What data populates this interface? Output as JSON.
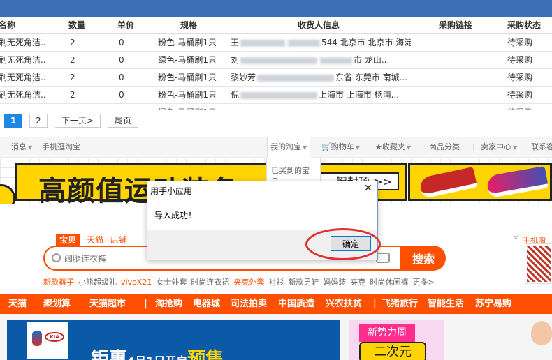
{
  "table": {
    "headers": [
      "品名称",
      "数量",
      "单价",
      "规格",
      "收货人信息",
      "采购链接",
      "采购状态"
    ],
    "rows": [
      {
        "name": "桶刷无死角洁..",
        "qty": "2",
        "price": "0",
        "spec": "粉色-马桶刷1只",
        "recv_a": "王",
        "recv_b": "544 北京市 北京市 海淀...",
        "status": "待采购"
      },
      {
        "name": "桶刷无死角洁..",
        "qty": "2",
        "price": "0",
        "spec": "绿色-马桶刷1只",
        "recv_a": "刘",
        "recv_b": "市 龙山...",
        "status": "待采购"
      },
      {
        "name": "桶刷无死角洁..",
        "qty": "2",
        "price": "0",
        "spec": "粉色-马桶刷1只",
        "recv_a": "黎妙芳",
        "recv_b": "东省 东莞市 南城...",
        "status": "待采购"
      },
      {
        "name": "桶刷无死角洁..",
        "qty": "2",
        "price": "0",
        "spec": "粉色-马桶刷1只",
        "recv_a": "倪",
        "recv_b": "上海市 上海市 杨浦...",
        "status": "待采购"
      }
    ],
    "partial_row": {
      "spec": "绿色-马桶刷1只",
      "status": "待采购"
    }
  },
  "pager": {
    "page1": "1",
    "page2": "2",
    "next": "下一页>",
    "last": "尾页"
  },
  "taobao_nav": {
    "messages": "消息",
    "mobile": "手机逛淘宝",
    "my_taobao": "我的淘宝",
    "cart": "购物车",
    "favorites": "收藏夹",
    "categories": "商品分类",
    "seller": "卖家中心",
    "contact": "联系客",
    "dropdown_item": "已买到的宝贝"
  },
  "banner": {
    "title": "高颜值运动装备",
    "button": "一键封顶 >>"
  },
  "search": {
    "tabs": [
      "宝贝",
      "天猫",
      "店铺"
    ],
    "placeholder": "阔腿连衣裤",
    "button": "搜索",
    "hot": [
      "新款裤子",
      "小熊超级礼",
      "vivoX21",
      "女士外套",
      "时尚连衣裙",
      "夹克外套",
      "衬衫",
      "新款男鞋",
      "妈妈装",
      "夹克",
      "时尚休闲裤",
      "更多>"
    ],
    "side_title": "手机淘"
  },
  "orange_nav": [
    "天猫",
    "聚划算",
    "天猫超市",
    "|",
    "淘抢购",
    "电器城",
    "司法拍卖",
    "中国质造",
    "兴农扶贫",
    "|",
    "飞猪旅行",
    "智能生活",
    "苏宁易购"
  ],
  "promo": {
    "text_a": "钜惠",
    "text_b": "4月1日开启",
    "text_c": "预售",
    "kia": "KIA",
    "fashion_tag": "新势力周",
    "fashion_sub": "二次元"
  },
  "dialog": {
    "title": "用手小应用",
    "message": "导入成功！",
    "ok": "确定",
    "close": "✕"
  },
  "colors": {
    "accent": "#ff5000",
    "highlight": "#e03030",
    "topbar": "#3a6fb5"
  }
}
